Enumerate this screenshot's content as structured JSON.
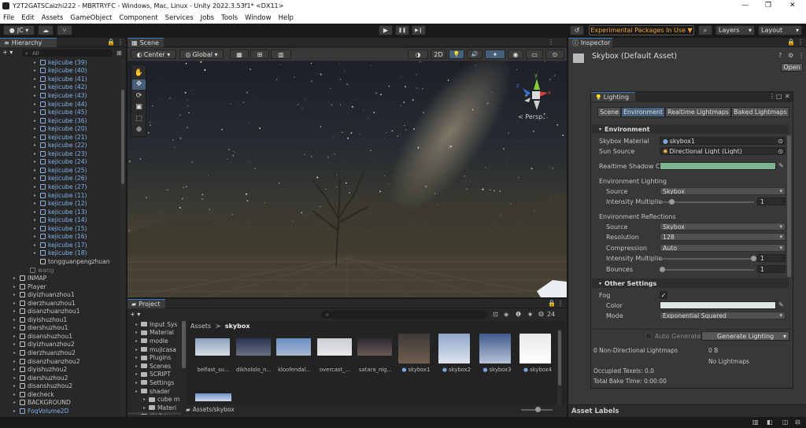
{
  "window": {
    "title": "Y2T2GATSCaizhi222 - MBRTRYFC - Windows, Mac, Linux - Unity 2022.3.53f1* <DX11>",
    "controls": {
      "minimize": "—",
      "maximize": "❐",
      "close": "✕"
    }
  },
  "menu": [
    "File",
    "Edit",
    "Assets",
    "GameObject",
    "Component",
    "Services",
    "Jobs",
    "Tools",
    "Window",
    "Help"
  ],
  "toolbar": {
    "account": "JC",
    "account_arrow": "▾",
    "cloud_icon": "☁",
    "collab_icon": "⑂",
    "play_icon": "▶",
    "pause_icon": "❚❚",
    "step_icon": "▶❙",
    "history_icon": "↺",
    "experimental": "Experimental Packages In Use ▼",
    "search_icon": "⌕",
    "layers": "Layers",
    "layout": "Layout"
  },
  "hierarchy": {
    "tab": "Hierarchy",
    "add": "+ ▾",
    "search_placeholder": "All",
    "items": [
      {
        "label": "kejicube (39)",
        "indent": 3,
        "type": "blue"
      },
      {
        "label": "kejicube (40)",
        "indent": 3,
        "type": "blue"
      },
      {
        "label": "kejicube (41)",
        "indent": 3,
        "type": "blue"
      },
      {
        "label": "kejicube (42)",
        "indent": 3,
        "type": "blue"
      },
      {
        "label": "kejicube (43)",
        "indent": 3,
        "type": "blue"
      },
      {
        "label": "kejicube (44)",
        "indent": 3,
        "type": "blue"
      },
      {
        "label": "kejicube (45)",
        "indent": 3,
        "type": "blue"
      },
      {
        "label": "kejicube (36)",
        "indent": 3,
        "type": "blue"
      },
      {
        "label": "kejicube (20)",
        "indent": 3,
        "type": "blue"
      },
      {
        "label": "kejicube (21)",
        "indent": 3,
        "type": "blue"
      },
      {
        "label": "kejicube (22)",
        "indent": 3,
        "type": "blue"
      },
      {
        "label": "kejicube (23)",
        "indent": 3,
        "type": "blue"
      },
      {
        "label": "kejicube (24)",
        "indent": 3,
        "type": "blue"
      },
      {
        "label": "kejicube (25)",
        "indent": 3,
        "type": "blue"
      },
      {
        "label": "kejicube (26)",
        "indent": 3,
        "type": "blue"
      },
      {
        "label": "kejicube (27)",
        "indent": 3,
        "type": "blue"
      },
      {
        "label": "kejicube (11)",
        "indent": 3,
        "type": "blue"
      },
      {
        "label": "kejicube (12)",
        "indent": 3,
        "type": "blue"
      },
      {
        "label": "kejicube (13)",
        "indent": 3,
        "type": "blue"
      },
      {
        "label": "kejicube (14)",
        "indent": 3,
        "type": "blue"
      },
      {
        "label": "kejicube (15)",
        "indent": 3,
        "type": "blue"
      },
      {
        "label": "kejicube (16)",
        "indent": 3,
        "type": "blue"
      },
      {
        "label": "kejicube (17)",
        "indent": 3,
        "type": "blue"
      },
      {
        "label": "kejicube (18)",
        "indent": 3,
        "type": "blue"
      },
      {
        "label": "tongguanpengzhuan",
        "indent": 3,
        "type": "white"
      },
      {
        "label": "wang",
        "indent": 2,
        "type": "grey"
      },
      {
        "label": "INMAP",
        "indent": 1,
        "type": "white"
      },
      {
        "label": "Player",
        "indent": 1,
        "type": "white"
      },
      {
        "label": "diyizhuanzhou1",
        "indent": 1,
        "type": "white"
      },
      {
        "label": "dierzhuanzhou1",
        "indent": 1,
        "type": "white"
      },
      {
        "label": "disanzhuanzhou1",
        "indent": 1,
        "type": "white"
      },
      {
        "label": "diyishuzhou1",
        "indent": 1,
        "type": "white"
      },
      {
        "label": "diershuzhou1",
        "indent": 1,
        "type": "white"
      },
      {
        "label": "disanshuzhou1",
        "indent": 1,
        "type": "white"
      },
      {
        "label": "diyizhuanzhou2",
        "indent": 1,
        "type": "white"
      },
      {
        "label": "dierzhuanzhou2",
        "indent": 1,
        "type": "white"
      },
      {
        "label": "disanzhuanzhou2",
        "indent": 1,
        "type": "white"
      },
      {
        "label": "diyishuzhou2",
        "indent": 1,
        "type": "white"
      },
      {
        "label": "diershuzhou2",
        "indent": 1,
        "type": "white"
      },
      {
        "label": "disanshuzhou2",
        "indent": 1,
        "type": "white"
      },
      {
        "label": "diecheck",
        "indent": 1,
        "type": "white"
      },
      {
        "label": "BACKGROUND",
        "indent": 1,
        "type": "white"
      },
      {
        "label": "FogVolume2D",
        "indent": 1,
        "type": "blue"
      }
    ]
  },
  "scene": {
    "tab": "Scene",
    "center": "Center",
    "global": "Global",
    "btn_2d": "2D",
    "persp": "< Persp",
    "tools": [
      "hand",
      "move",
      "rotate",
      "scale",
      "rect",
      "transform"
    ],
    "glyphs": {
      "hand": "✋",
      "move": "✥",
      "rotate": "⟳",
      "scale": "▣",
      "rect": "⬚",
      "transform": "⊕",
      "center": "◐",
      "global": "◎",
      "grid": "▦",
      "snap": "⊞",
      "snap2": "▥",
      "shading": "◑",
      "light": "💡",
      "audio": "🔊",
      "fx": "✦",
      "visibility": "◉",
      "camera": "▭",
      "gizmos": "⊙"
    },
    "axis": {
      "y": "y",
      "x": "x",
      "z": "z"
    }
  },
  "project": {
    "tab": "Project",
    "add": "+ ▾",
    "count": "24",
    "path_root": "Assets",
    "path_sep": ">",
    "path_leaf": "skybox",
    "footer_path": "Assets/skybox",
    "folders": [
      {
        "label": "Input Sys",
        "indent": 1
      },
      {
        "label": "Material",
        "indent": 1
      },
      {
        "label": "modle",
        "indent": 1
      },
      {
        "label": "mujicasa",
        "indent": 1
      },
      {
        "label": "Plugins",
        "indent": 1
      },
      {
        "label": "Scenes",
        "indent": 1
      },
      {
        "label": "SCRIPT",
        "indent": 1
      },
      {
        "label": "Settings",
        "indent": 1
      },
      {
        "label": "shader",
        "indent": 1
      },
      {
        "label": "cube m",
        "indent": 2
      },
      {
        "label": "Materi",
        "indent": 2
      },
      {
        "label": "skybox",
        "indent": 1
      }
    ],
    "assets_row1": [
      {
        "label": "belfast_su...",
        "kind": "hdr",
        "c1": "#8aa0c0",
        "c2": "#d8dde6"
      },
      {
        "label": "dikhololo_n...",
        "kind": "hdr",
        "c1": "#2a3550",
        "c2": "#6b7080"
      },
      {
        "label": "kloofendal...",
        "kind": "hdr",
        "c1": "#6a8ec6",
        "c2": "#a9b9d0"
      },
      {
        "label": "overcast_...",
        "kind": "hdr",
        "c1": "#c9cdd3",
        "c2": "#e8e9ea"
      },
      {
        "label": "satara_nig...",
        "kind": "hdr",
        "c1": "#2c2a33",
        "c2": "#6a5a55"
      },
      {
        "label": "skybox1",
        "kind": "mat",
        "c1": "#3d3a38",
        "c2": "#6e5e4e"
      },
      {
        "label": "skybox2",
        "kind": "mat",
        "c1": "#8fa6cc",
        "c2": "#dfe5ee"
      },
      {
        "label": "skybox3",
        "kind": "mat",
        "c1": "#405a8c",
        "c2": "#b7c3d8"
      },
      {
        "label": "skybox4",
        "kind": "mat",
        "c1": "#e6e8ea",
        "c2": "#ffffff"
      }
    ]
  },
  "inspector": {
    "tab": "Inspector",
    "title": "Skybox (Default Asset)",
    "open": "Open",
    "lock_icon": "🔒",
    "menu_icon": "⋮",
    "info_icon": "?",
    "settings_icon": "⚙",
    "asset_labels": "Asset Labels"
  },
  "lighting": {
    "title": "Lighting",
    "light_icon": "💡",
    "window_icon": "□",
    "close_icon": "✕",
    "check_mark": "✓",
    "tabs": [
      "Scene",
      "Environment",
      "Realtime Lightmaps",
      "Baked Lightmaps"
    ],
    "environment_header": "Environment",
    "skybox_material_label": "Skybox Material",
    "skybox_material_value": "skybox1",
    "sun_source_label": "Sun Source",
    "sun_source_value": "Directional Light (Light)",
    "realtime_shadow_label": "Realtime Shadow C",
    "realtime_shadow_color": "#7cb58f",
    "env_lighting_label": "Environment Lighting",
    "source_label": "Source",
    "source_value": "Skybox",
    "intensity_label": "Intensity Multiplie",
    "intensity_value": "1",
    "intensity_fraction": 0.1,
    "env_reflections_label": "Environment Reflections",
    "refl_source_label": "Source",
    "refl_source_value": "Skybox",
    "resolution_label": "Resolution",
    "resolution_value": "128",
    "compression_label": "Compression",
    "compression_value": "Auto",
    "refl_intensity_label": "Intensity Multiplie",
    "refl_intensity_value": "1",
    "refl_intensity_fraction": 1.0,
    "bounces_label": "Bounces",
    "bounces_value": "1",
    "bounces_fraction": 0.0,
    "other_header": "Other Settings",
    "fog_label": "Fog",
    "color_label": "Color",
    "fog_color": "#dde6e2",
    "mode_label": "Mode",
    "mode_value": "Exponential Squared",
    "auto_generate": "Auto Generate",
    "generate": "Generate Lighting",
    "stats": {
      "non_dir": "0 Non-Directional Lightmaps",
      "size": "0 B",
      "no_lightmaps": "No Lightmaps",
      "texels": "Occupied Texels: 0.0",
      "bake_time": "Total Bake Time: 0:00:00"
    }
  }
}
